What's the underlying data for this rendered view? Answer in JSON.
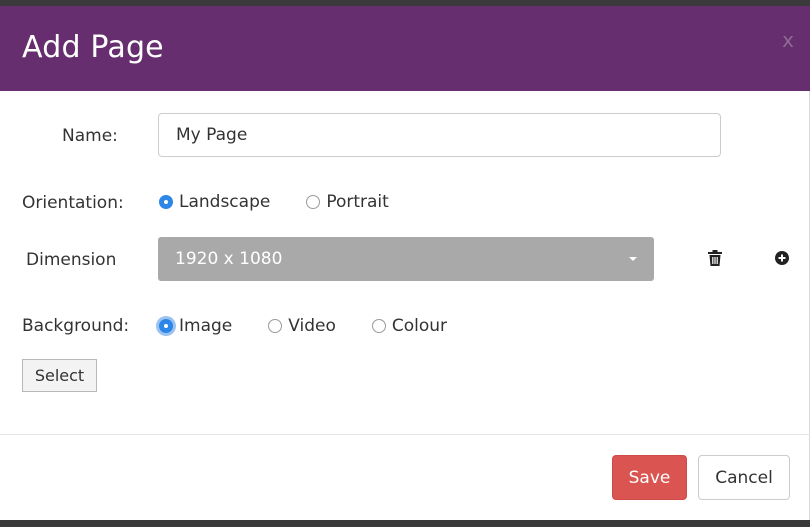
{
  "modal": {
    "title": "Add Page",
    "close_label": "x"
  },
  "form": {
    "name": {
      "label": "Name:",
      "value": "My Page"
    },
    "orientation": {
      "label": "Orientation:",
      "options": [
        "Landscape",
        "Portrait"
      ],
      "selected": "Landscape"
    },
    "dimension": {
      "label": "Dimension",
      "selected": "1920 x 1080",
      "delete_icon": "trash-icon",
      "add_icon": "plus-circle-icon"
    },
    "background": {
      "label": "Background:",
      "options": [
        "Image",
        "Video",
        "Colour"
      ],
      "selected": "Image"
    },
    "select_button": "Select"
  },
  "footer": {
    "save_label": "Save",
    "cancel_label": "Cancel"
  },
  "colors": {
    "header": "#662e6e",
    "save": "#da5451",
    "radio_checked": "#2c87e8",
    "select_bg": "#a9a9a9"
  }
}
